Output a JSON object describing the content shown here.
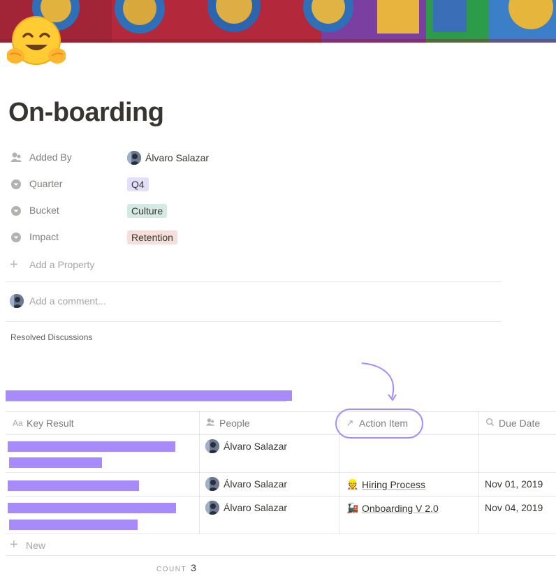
{
  "page": {
    "title": "On-boarding",
    "icon": "hugging-face-emoji"
  },
  "properties": [
    {
      "label": "Added By",
      "icon": "person-icon",
      "type": "person",
      "value": "Álvaro Salazar"
    },
    {
      "label": "Quarter",
      "icon": "select-icon",
      "type": "tag",
      "value": "Q4",
      "color": "#e3defa"
    },
    {
      "label": "Bucket",
      "icon": "select-icon",
      "type": "tag",
      "value": "Culture",
      "color": "#d3e9e2"
    },
    {
      "label": "Impact",
      "icon": "select-icon",
      "type": "tag",
      "value": "Retention",
      "color": "#f4dfdb"
    }
  ],
  "add_property_label": "Add a Property",
  "comment_placeholder": "Add a comment...",
  "resolved_discussions_label": "Resolved Discussions",
  "database": {
    "columns": [
      {
        "label": "Key Result",
        "icon": "text-property-icon"
      },
      {
        "label": "People",
        "icon": "person-icon"
      },
      {
        "label": "Action Item",
        "icon": "relation-arrow-icon"
      },
      {
        "label": "Due Date",
        "icon": "search-icon"
      }
    ],
    "rows": [
      {
        "people": "Álvaro Salazar",
        "action_emoji": "",
        "action": "",
        "due": ""
      },
      {
        "people": "Álvaro Salazar",
        "action_emoji": "👷",
        "action": "Hiring Process",
        "due": "Nov 01, 2019"
      },
      {
        "people": "Álvaro Salazar",
        "action_emoji": "🚂",
        "action": "Onboarding V 2.0",
        "due": "Nov 04, 2019"
      }
    ],
    "new_label": "New",
    "count_label": "COUNT",
    "count_value": "3"
  },
  "colors": {
    "annotation": "#a78bfa",
    "redaction": "#a78bfa"
  }
}
